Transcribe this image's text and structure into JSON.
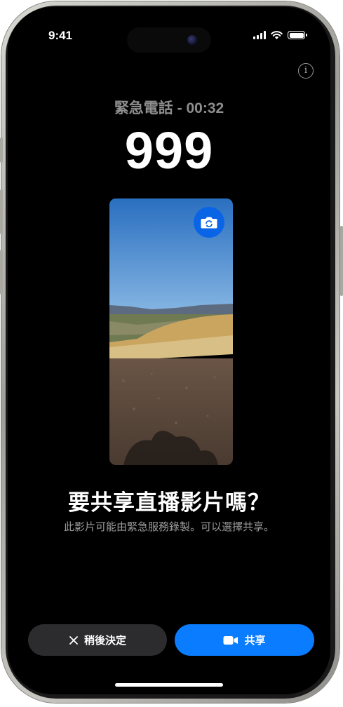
{
  "status_bar": {
    "time": "9:41"
  },
  "call": {
    "status": "緊急電話 - 00:32",
    "number": "999"
  },
  "icons": {
    "info": "info-circle-icon",
    "flip_camera": "camera-flip-icon",
    "close": "close-x-icon",
    "video": "video-camera-icon"
  },
  "prompt": {
    "title": "要共享直播影片嗎？",
    "subtitle": "此影片可能由緊急服務錄製。可以選擇共享。"
  },
  "buttons": {
    "decide_later": "稍後決定",
    "share": "共享"
  },
  "colors": {
    "background": "#000000",
    "accent_blue": "#0a7cff",
    "secondary_button": "#2c2c2e",
    "muted_text": "#8e8e8e"
  }
}
